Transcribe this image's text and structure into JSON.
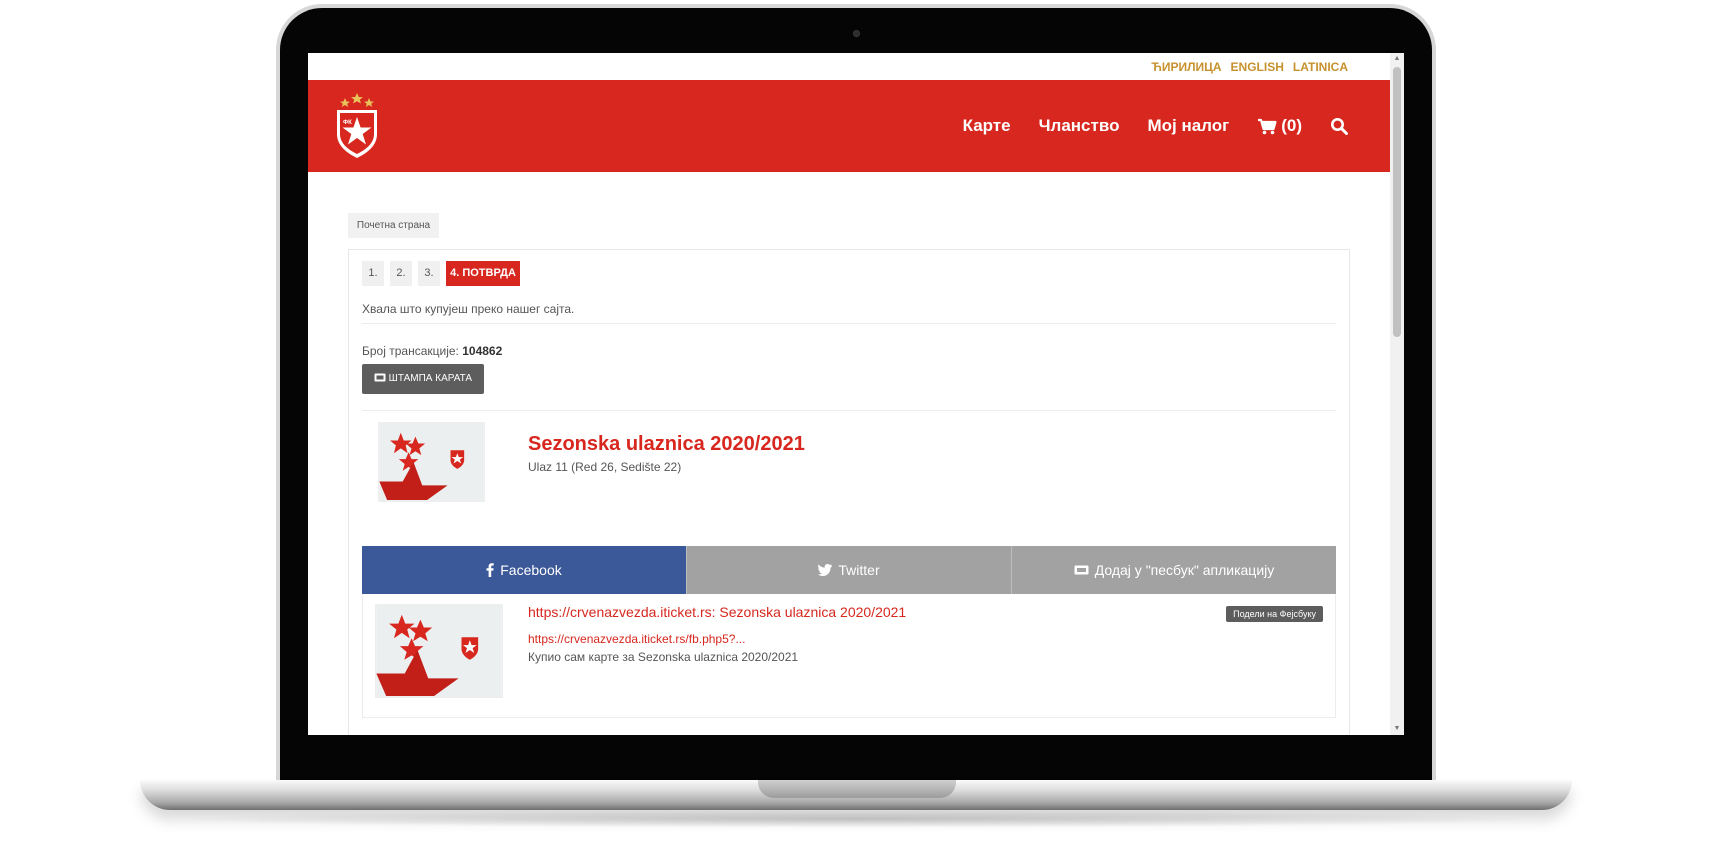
{
  "languages": [
    "ЋИРИЛИЦА",
    "ENGLISH",
    "LATINICA"
  ],
  "nav": {
    "tickets": "Карте",
    "membership": "Чланство",
    "account": "Мој налог",
    "cart_count": "(0)"
  },
  "breadcrumb": "Почетна страна",
  "steps": [
    "1.",
    "2.",
    "3.",
    "4. ПОТВРДА"
  ],
  "thanks_text": "Хвала што купујеш преко нашег сајта.",
  "transaction": {
    "label": "Број трансакције:",
    "number": "104862"
  },
  "print_button": "ШТАМПА КАРАТА",
  "ticket": {
    "title": "Sezonska ulaznica 2020/2021",
    "details": "Ulaz 11 (Red 26, Sedište 22)"
  },
  "share": {
    "facebook": "Facebook",
    "twitter": "Twitter",
    "passbook": "Додај у \"песбук\" апликацију"
  },
  "preview": {
    "title": "https://crvenazvezda.iticket.rs: Sezonska ulaznica 2020/2021",
    "url": "https://crvenazvezda.iticket.rs/fb.php5?...",
    "description": "Купио сам карте за Sezonska ulaznica 2020/2021",
    "share_button": "Подели на Фејсбуку"
  },
  "colors": {
    "brand_red": "#d7271e",
    "gold": "#c7922e",
    "facebook_blue": "#3b5898",
    "grey_button": "#5d5d5d"
  }
}
